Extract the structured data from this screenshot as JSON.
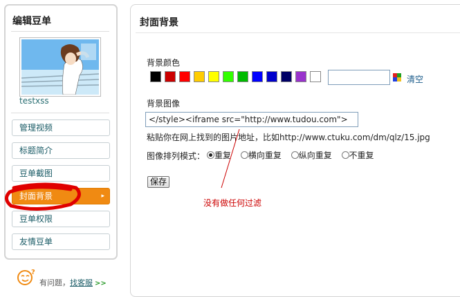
{
  "sidebar": {
    "title": "编辑豆单",
    "username": "testxss",
    "items": [
      {
        "label": "管理视频",
        "active": false
      },
      {
        "label": "标题简介",
        "active": false
      },
      {
        "label": "豆单截图",
        "active": false
      },
      {
        "label": "封面背景",
        "active": true
      },
      {
        "label": "豆单权限",
        "active": false
      },
      {
        "label": "友情豆单",
        "active": false
      }
    ],
    "active_arrow": "▸",
    "help": {
      "text": "有问题，",
      "link": "找客服",
      "arrow": ">>"
    }
  },
  "main": {
    "title": "封面背景",
    "bg_color_label": "背景颜色",
    "swatch_colors": [
      "#000000",
      "#cc0000",
      "#ff0000",
      "#ffcc00",
      "#ffff00",
      "#33ff00",
      "#00bb00",
      "#0000ff",
      "#0000cc",
      "#000066",
      "#9933cc",
      "#ffffff"
    ],
    "color_input_value": "",
    "clear_label": "清空",
    "bg_image_label": "背景图像",
    "bg_image_value": "</style><iframe src=\"http://www.tudou.com\">",
    "paste_hint": "粘贴你在网上找到的图片地址，比如http://www.ctuku.com/dm/qlz/15.jpg",
    "arrange_label": "图像排列模式：",
    "arrange_options": [
      {
        "label": "重复",
        "selected": true
      },
      {
        "label": "横向重复",
        "selected": false
      },
      {
        "label": "纵向重复",
        "selected": false
      },
      {
        "label": "不重复",
        "selected": false
      }
    ],
    "save_label": "保存",
    "annotation": "没有做任何过滤"
  },
  "colors": {
    "accent": "#f08a12",
    "link": "#1a5b66",
    "annotation": "#cc0000"
  }
}
